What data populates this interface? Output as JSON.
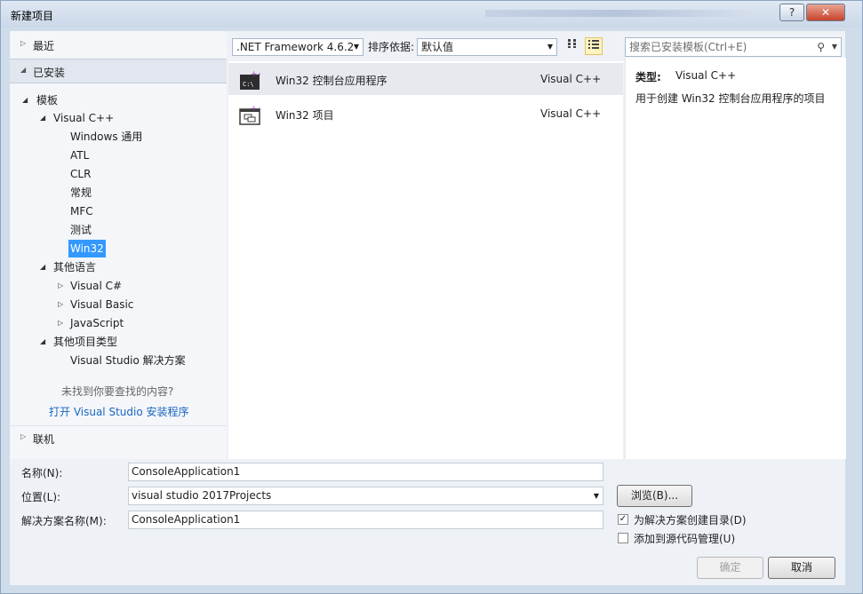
{
  "window": {
    "title": "新建项目",
    "help": "?",
    "close": "✕"
  },
  "left": {
    "recent": "最近",
    "installed": "已安装",
    "templates": "模板",
    "vcpp": "Visual C++",
    "vcpp_children": [
      "Windows 通用",
      "ATL",
      "CLR",
      "常规",
      "MFC",
      "测试",
      "Win32"
    ],
    "other_langs": "其他语言",
    "other_lang_children": [
      "Visual C#",
      "Visual Basic",
      "JavaScript"
    ],
    "other_types": "其他项目类型",
    "vs_solution": "Visual Studio 解决方案",
    "not_found": "未找到你要查找的内容?",
    "open_installer": "打开 Visual Studio 安装程序",
    "online": "联机"
  },
  "toolbar": {
    "framework": ".NET Framework 4.6.2",
    "sort_label": "排序依据:",
    "sort_value": "默认值",
    "search_placeholder": "搜索已安装模板(Ctrl+E)"
  },
  "templates": [
    {
      "name": "Win32 控制台应用程序",
      "lang": "Visual C++",
      "selected": true
    },
    {
      "name": "Win32 项目",
      "lang": "Visual C++",
      "selected": false
    }
  ],
  "details": {
    "type_label": "类型:",
    "type_value": "Visual C++",
    "description": "用于创建 Win32 控制台应用程序的项目"
  },
  "form": {
    "name_label": "名称(N):",
    "name_value": "ConsoleApplication1",
    "location_label": "位置(L):",
    "location_value": "visual studio 2017Projects",
    "solution_label": "解决方案名称(M):",
    "solution_value": "ConsoleApplication1",
    "browse": "浏览(B)...",
    "create_dir": "为解决方案创建目录(D)",
    "create_dir_checked": true,
    "add_scm": "添加到源代码管理(U)",
    "add_scm_checked": false,
    "ok": "确定",
    "cancel": "取消"
  },
  "colors": {
    "accent": "#3399ff",
    "link": "#1a66c2"
  }
}
